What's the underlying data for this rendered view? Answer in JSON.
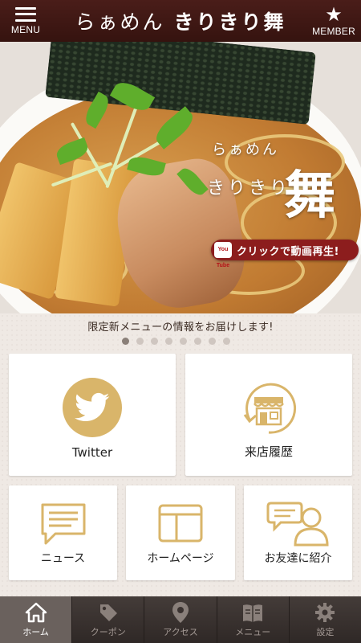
{
  "header": {
    "title_prefix": "らぁめん",
    "title_brand": "きりきり舞",
    "menu_label": "MENU",
    "member_label": "MEMBER",
    "member_icon": "star-icon",
    "menu_icon": "hamburger-icon"
  },
  "hero": {
    "brand_line1": "らぁめん",
    "brand_line2": "きりきり",
    "brand_big": "舞",
    "youtube_badge": "You Tube",
    "play_text": "クリックで動画再生!"
  },
  "notice": {
    "text": "限定新メニューの情報をお届けします!",
    "page_count": 8,
    "active_page": 1
  },
  "tiles": [
    {
      "label": "Twitter",
      "icon": "twitter-bird-icon"
    },
    {
      "label": "来店履歴",
      "icon": "shop-history-icon"
    },
    {
      "label": "ニュース",
      "icon": "news-icon"
    },
    {
      "label": "ホームページ",
      "icon": "homepage-window-icon"
    },
    {
      "label": "お友達に紹介",
      "icon": "friend-referral-icon"
    }
  ],
  "bottom_nav": [
    {
      "label": "ホーム",
      "icon": "home-icon",
      "active": true
    },
    {
      "label": "クーポン",
      "icon": "coupon-tag-icon",
      "active": false
    },
    {
      "label": "アクセス",
      "icon": "map-pin-icon",
      "active": false
    },
    {
      "label": "メニュー",
      "icon": "menu-book-icon",
      "active": false
    },
    {
      "label": "設定",
      "icon": "gear-icon",
      "active": false
    }
  ],
  "colors": {
    "header_bg": "#3f1815",
    "accent_gold": "#d9b56a",
    "nav_bg": "#3a3230",
    "nav_active": "#6a615d",
    "play_banner": "#8c1d1d"
  }
}
